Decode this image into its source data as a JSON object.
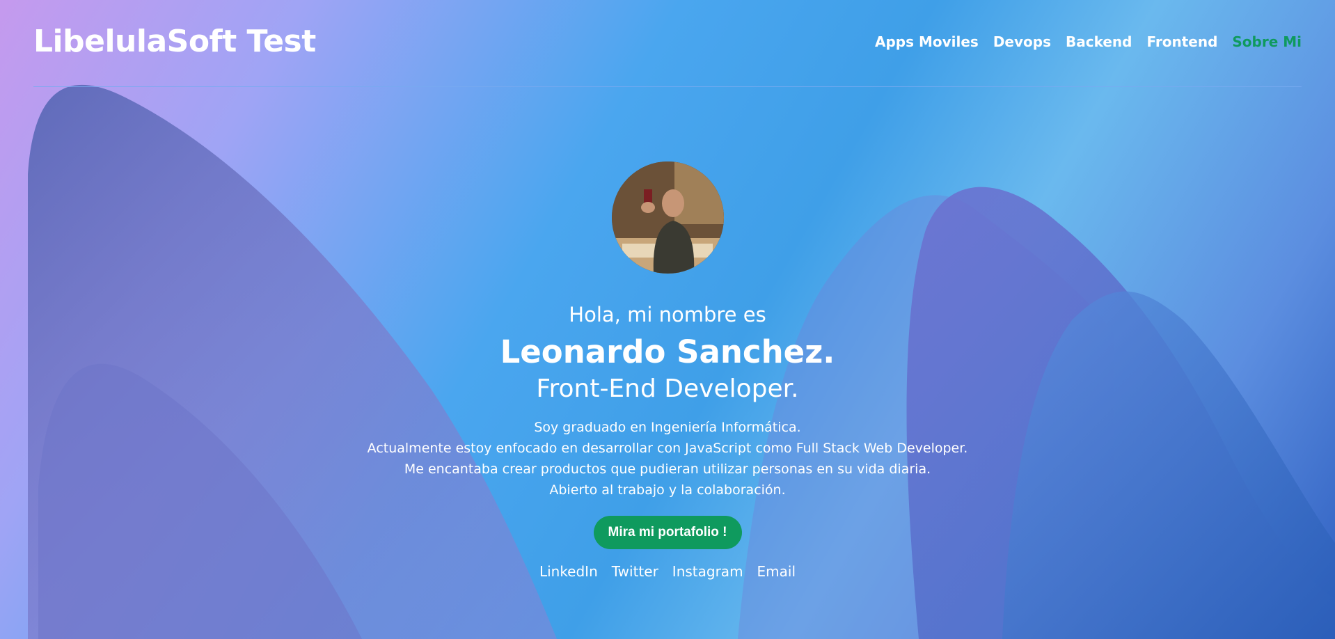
{
  "header": {
    "brand": "LibelulaSoft Test",
    "nav": [
      {
        "label": "Apps Moviles"
      },
      {
        "label": "Devops"
      },
      {
        "label": "Backend"
      },
      {
        "label": "Frontend"
      },
      {
        "label": "Sobre Mi",
        "active": true
      }
    ]
  },
  "hero": {
    "greeting": "Hola, mi nombre es",
    "name": "Leonardo Sanchez.",
    "role": "Front-End Developer.",
    "bio": [
      "Soy graduado en Ingeniería Informática.",
      "Actualmente estoy enfocado en desarrollar con JavaScript como Full Stack Web Developer.",
      "Me encantaba crear productos que pudieran utilizar personas en su vida diaria.",
      "Abierto al trabajo y la colaboración."
    ],
    "cta_label": "Mira mi portafolio !",
    "socials": [
      "LinkedIn",
      "Twitter",
      "Instagram",
      "Email"
    ]
  },
  "colors": {
    "accent": "#0f9a5e",
    "text": "#ffffff"
  }
}
